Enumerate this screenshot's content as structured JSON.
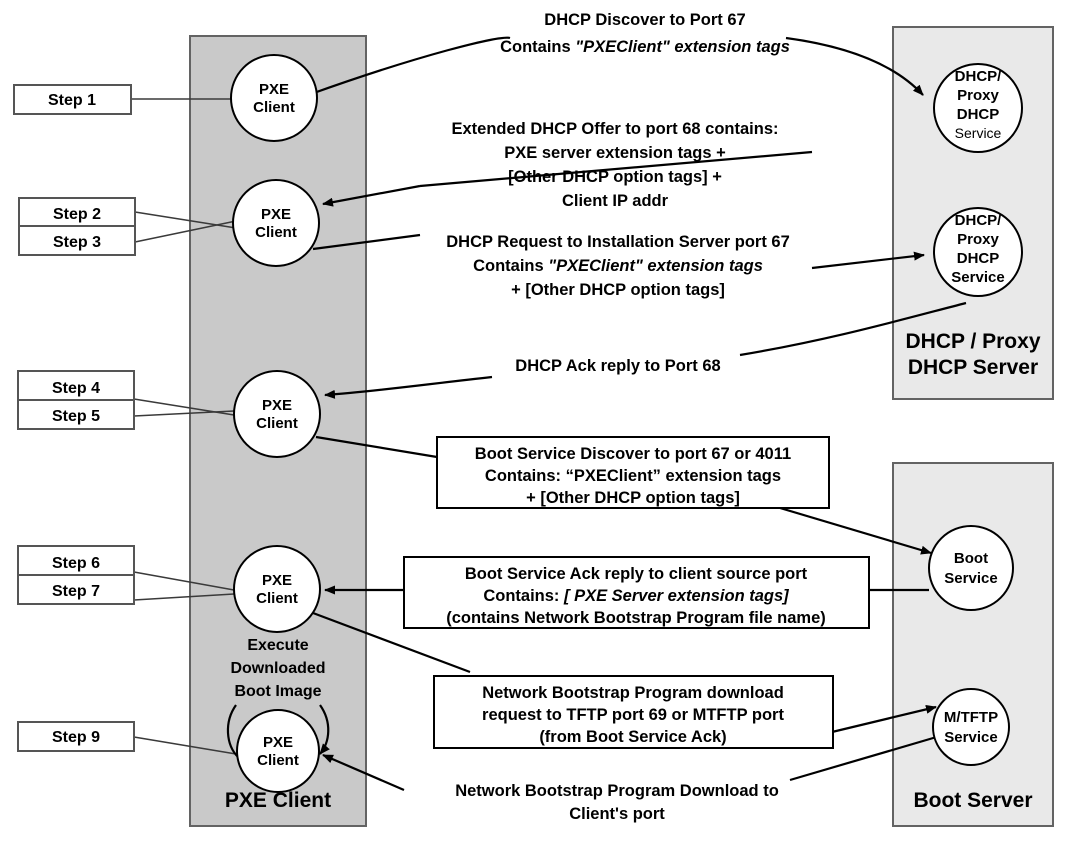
{
  "diagram": {
    "title": "PXE Client / Server Boot Sequence",
    "colors": {
      "client_column": "#c9c9c9",
      "server_column": "#e9e9e9",
      "node_fill": "#ffffff",
      "stroke": "#000000"
    }
  },
  "columns": {
    "client": {
      "label": "PXE Client"
    },
    "dhcp_server": {
      "label_line1": "DHCP / Proxy",
      "label_line2": "DHCP Server"
    },
    "boot_server": {
      "label": "Boot Server"
    }
  },
  "steps": [
    {
      "label": "Step 1"
    },
    {
      "label": "Step 2"
    },
    {
      "label": "Step 3"
    },
    {
      "label": "Step 4"
    },
    {
      "label": "Step 5"
    },
    {
      "label": "Step 6"
    },
    {
      "label": "Step 7"
    },
    {
      "label": "Step 9"
    }
  ],
  "client_nodes": [
    {
      "line1": "PXE",
      "line2": "Client"
    },
    {
      "line1": "PXE",
      "line2": "Client"
    },
    {
      "line1": "PXE",
      "line2": "Client"
    },
    {
      "line1": "PXE",
      "line2": "Client"
    },
    {
      "line1": "PXE",
      "line2": "Client"
    }
  ],
  "client_annotation": {
    "line1": "Execute",
    "line2": "Downloaded",
    "line3": "Boot Image"
  },
  "server_nodes": [
    {
      "lines": [
        "DHCP/",
        "Proxy",
        "DHCP",
        "Service"
      ],
      "last_line_bold": false
    },
    {
      "lines": [
        "DHCP/",
        "Proxy",
        "DHCP",
        "Service"
      ],
      "last_line_bold": true
    },
    {
      "lines": [
        "Boot",
        "Service"
      ],
      "last_line_bold": true
    },
    {
      "lines": [
        "M/TFTP",
        "Service"
      ],
      "last_line_bold": true
    }
  ],
  "messages": [
    {
      "id": "dhcp-discover",
      "boxed": false,
      "lines": [
        {
          "runs": [
            {
              "text": "DHCP Discover to Port 67",
              "italic": false
            }
          ]
        },
        {
          "runs": [
            {
              "text": "Contains  ",
              "italic": false
            },
            {
              "text": "\"PXEClient\" extension tags",
              "italic": true
            }
          ]
        }
      ]
    },
    {
      "id": "extended-dhcp-offer",
      "boxed": false,
      "lines": [
        {
          "runs": [
            {
              "text": "Extended DHCP Offer to port 68 contains:",
              "italic": false
            }
          ]
        },
        {
          "runs": [
            {
              "text": "PXE server extension tags +",
              "italic": false
            }
          ]
        },
        {
          "runs": [
            {
              "text": "[Other DHCP option tags] +",
              "italic": false
            }
          ]
        },
        {
          "runs": [
            {
              "text": "Client IP addr",
              "italic": false
            }
          ]
        }
      ]
    },
    {
      "id": "dhcp-request",
      "boxed": false,
      "lines": [
        {
          "runs": [
            {
              "text": "DHCP Request to Installation Server port 67",
              "italic": false
            }
          ]
        },
        {
          "runs": [
            {
              "text": "Contains  ",
              "italic": false
            },
            {
              "text": "\"PXEClient\" extension tags",
              "italic": true
            }
          ]
        },
        {
          "runs": [
            {
              "text": "+ [Other DHCP option tags]",
              "italic": false
            }
          ]
        }
      ]
    },
    {
      "id": "dhcp-ack",
      "boxed": false,
      "lines": [
        {
          "runs": [
            {
              "text": "DHCP Ack reply to Port 68",
              "italic": false
            }
          ]
        }
      ]
    },
    {
      "id": "boot-service-discover",
      "boxed": true,
      "lines": [
        {
          "runs": [
            {
              "text": "Boot Service Discover to port 67 or 4011",
              "italic": false
            }
          ]
        },
        {
          "runs": [
            {
              "text": "Contains: “PXEClient” extension tags",
              "italic": false
            }
          ]
        },
        {
          "runs": [
            {
              "text": "+ [Other DHCP option tags]",
              "italic": false
            }
          ]
        }
      ]
    },
    {
      "id": "boot-service-ack",
      "boxed": true,
      "lines": [
        {
          "runs": [
            {
              "text": "Boot Service Ack reply to client source port",
              "italic": false
            }
          ]
        },
        {
          "runs": [
            {
              "text": "Contains: ",
              "italic": false
            },
            {
              "text": "[ PXE Server extension tags]",
              "italic": true
            }
          ]
        },
        {
          "runs": [
            {
              "text": "(contains Network Bootstrap Program file name)",
              "italic": false
            }
          ]
        }
      ]
    },
    {
      "id": "nbp-download-request",
      "boxed": true,
      "lines": [
        {
          "runs": [
            {
              "text": "Network Bootstrap Program download",
              "italic": false
            }
          ]
        },
        {
          "runs": [
            {
              "text": "request to TFTP port 69 or MTFTP port",
              "italic": false
            }
          ]
        },
        {
          "runs": [
            {
              "text": "(from Boot Service Ack)",
              "italic": false
            }
          ]
        }
      ]
    },
    {
      "id": "nbp-download",
      "boxed": false,
      "lines": [
        {
          "runs": [
            {
              "text": "Network Bootstrap Program Download to",
              "italic": false
            }
          ]
        },
        {
          "runs": [
            {
              "text": "Client's port",
              "italic": false
            }
          ]
        }
      ]
    }
  ]
}
